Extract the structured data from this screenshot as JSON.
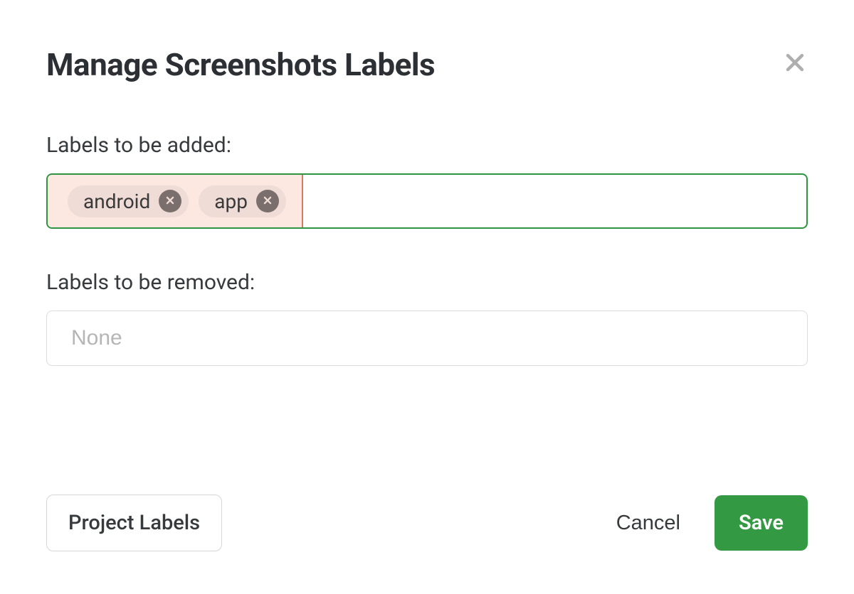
{
  "dialog": {
    "title": "Manage Screenshots Labels",
    "add_section_label": "Labels to be added:",
    "remove_section_label": "Labels to be removed:",
    "remove_placeholder": "None",
    "tags": [
      {
        "label": "android"
      },
      {
        "label": "app"
      }
    ]
  },
  "footer": {
    "project_labels": "Project Labels",
    "cancel": "Cancel",
    "save": "Save"
  }
}
